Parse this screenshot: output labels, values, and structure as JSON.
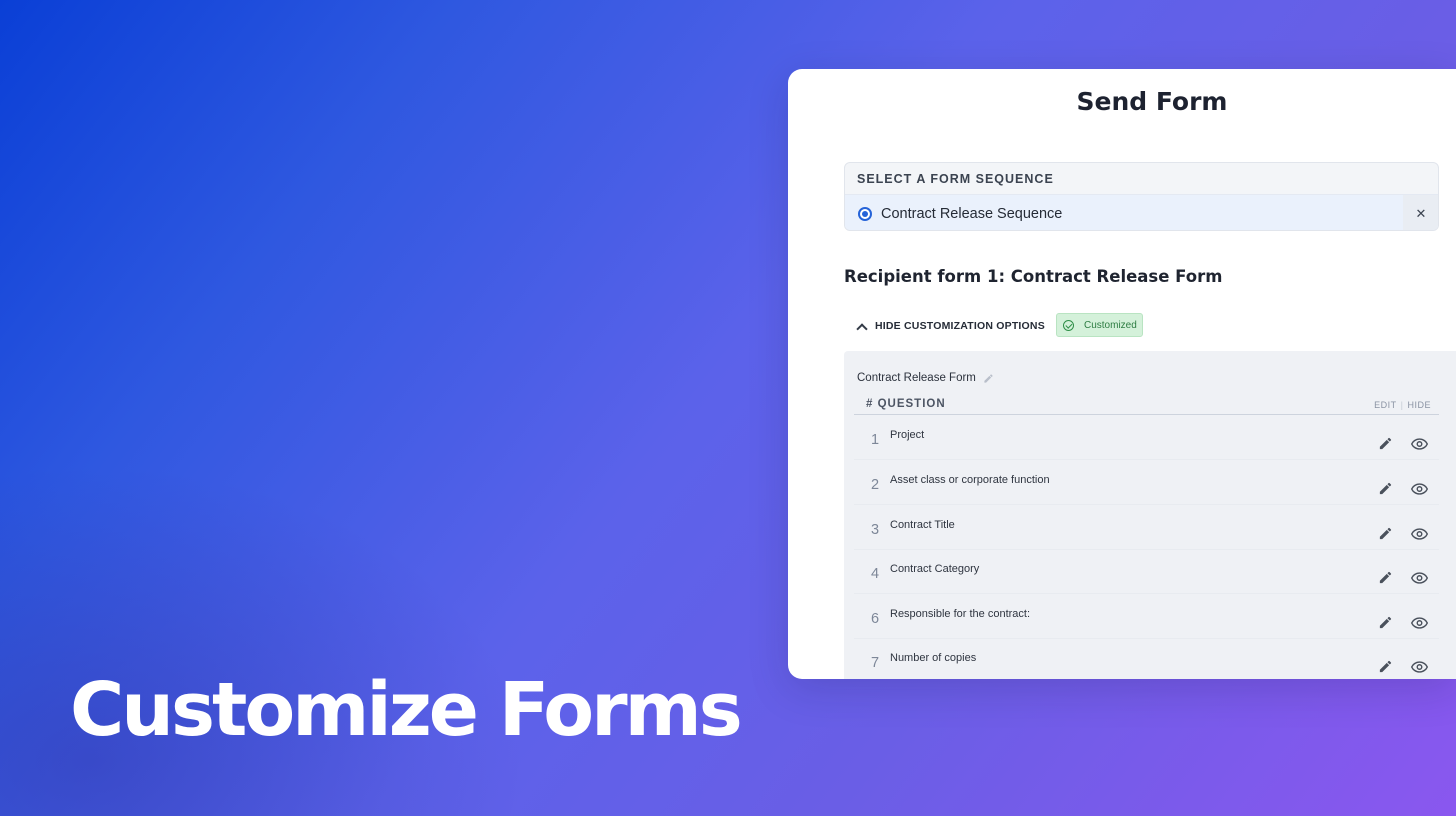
{
  "hero": {
    "title": "Customize Forms"
  },
  "dialog": {
    "title": "Send Form",
    "sequence": {
      "label": "SELECT A FORM SEQUENCE",
      "selected": "Contract Release Sequence",
      "clear_symbol": "✕"
    },
    "recipient_title": "Recipient form 1: Contract Release Form",
    "customization": {
      "toggle_label": "HIDE CUSTOMIZATION OPTIONS",
      "badge_label": "Customized"
    },
    "form": {
      "name": "Contract Release Form",
      "columns": {
        "number_question": "# QUESTION",
        "edit": "EDIT",
        "hide": "HIDE"
      },
      "questions": [
        {
          "number": "1",
          "text": "Project"
        },
        {
          "number": "2",
          "text": "Asset class or corporate function"
        },
        {
          "number": "3",
          "text": "Contract Title"
        },
        {
          "number": "4",
          "text": "Contract Category"
        },
        {
          "number": "6",
          "text": "Responsible for the contract:"
        },
        {
          "number": "7",
          "text": "Number of copies"
        }
      ]
    }
  },
  "icons": [
    "radio-selected-icon",
    "close-icon",
    "chevron-up-icon",
    "check-circle-icon",
    "pencil-icon",
    "eye-icon"
  ],
  "colors": {
    "accent": "#2563d8",
    "badge_bg": "#d4f1da",
    "badge_text": "#2e7d43"
  }
}
